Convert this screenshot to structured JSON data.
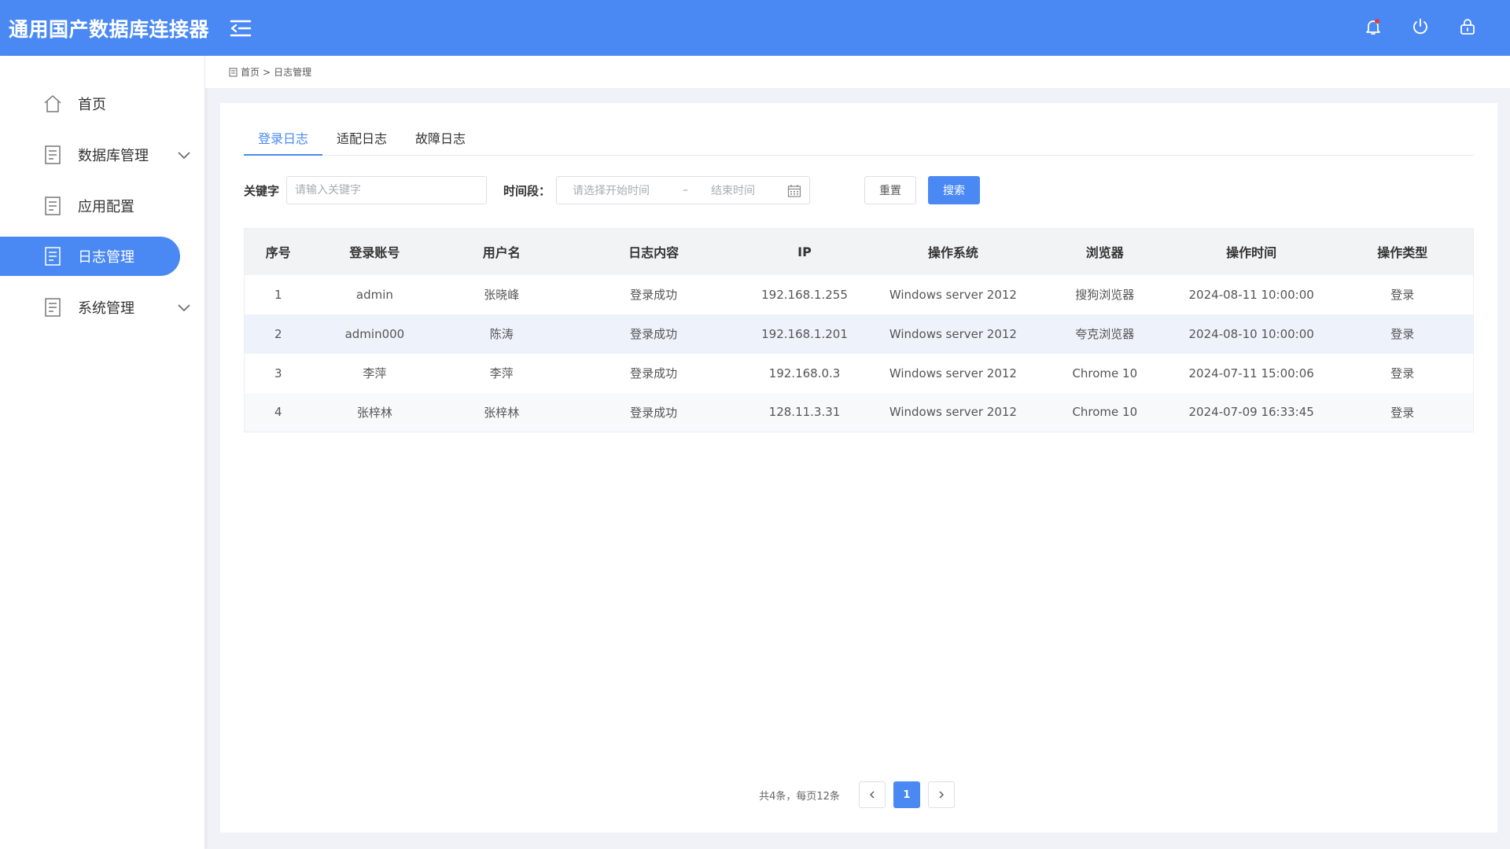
{
  "app": {
    "title": "通用国产数据库连接器"
  },
  "header_icons": [
    "menu-fold-icon",
    "bell-icon",
    "power-icon",
    "lock-icon"
  ],
  "sidebar": {
    "items": [
      {
        "label": "首页",
        "icon": "home-icon",
        "active": false,
        "expandable": false
      },
      {
        "label": "数据库管理",
        "icon": "document-icon",
        "active": false,
        "expandable": true
      },
      {
        "label": "应用配置",
        "icon": "document-icon",
        "active": false,
        "expandable": false
      },
      {
        "label": "日志管理",
        "icon": "document-icon",
        "active": true,
        "expandable": false
      },
      {
        "label": "系统管理",
        "icon": "document-icon",
        "active": false,
        "expandable": true
      }
    ]
  },
  "breadcrumb": {
    "home": "首页",
    "separator": ">",
    "current": "日志管理"
  },
  "tabs": [
    {
      "label": "登录日志",
      "active": true
    },
    {
      "label": "适配日志",
      "active": false
    },
    {
      "label": "故障日志",
      "active": false
    }
  ],
  "filters": {
    "keyword_label": "关键字",
    "keyword_placeholder": "请输入关键字",
    "keyword_value": "",
    "time_label": "时间段：",
    "start_placeholder": "请选择开始时间",
    "separator": "–",
    "end_placeholder": "结束时间",
    "reset_label": "重置",
    "search_label": "搜索"
  },
  "table": {
    "columns": [
      "序号",
      "登录账号",
      "用户名",
      "日志内容",
      "IP",
      "操作系统",
      "浏览器",
      "操作时间",
      "操作类型"
    ],
    "rows": [
      [
        "1",
        "admin",
        "张晓峰",
        "登录成功",
        "192.168.1.255",
        "Windows server 2012",
        "搜狗浏览器",
        "2024-08-11 10:00:00",
        "登录"
      ],
      [
        "2",
        "admin000",
        "陈涛",
        "登录成功",
        "192.168.1.201",
        "Windows server 2012",
        "夸克浏览器",
        "2024-08-10 10:00:00",
        "登录"
      ],
      [
        "3",
        "李萍",
        "李萍",
        "登录成功",
        "192.168.0.3",
        "Windows server 2012",
        "Chrome 10",
        "2024-07-11 15:00:06",
        "登录"
      ],
      [
        "4",
        "张梓林",
        "张梓林",
        "登录成功",
        "128.11.3.31",
        "Windows server 2012",
        "Chrome 10",
        "2024-07-09 16:33:45",
        "登录"
      ]
    ]
  },
  "pagination": {
    "summary": "共4条，每页12条",
    "current_page": "1"
  },
  "colors": {
    "accent": "#4a89f3",
    "header_bg": "#4a89f3",
    "row_highlight": "#eef2fb"
  }
}
